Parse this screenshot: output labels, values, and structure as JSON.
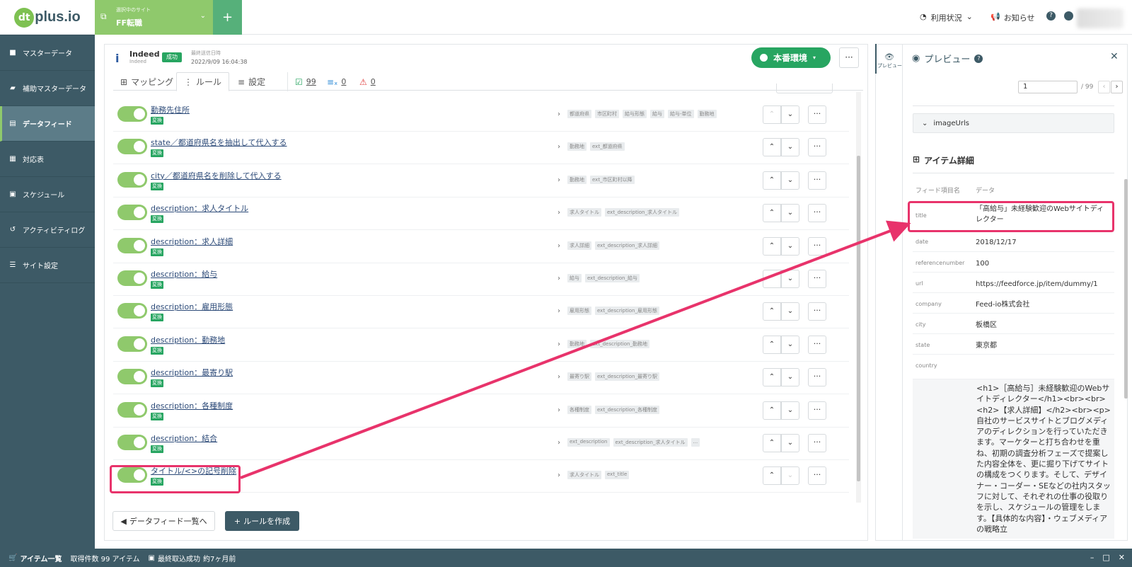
{
  "topbar": {
    "logo_mark": "dt",
    "logo_text": "plus.io",
    "site_label": "選択中のサイト",
    "site_name": "FF転職",
    "add_symbol": "+",
    "usage_label": "利用状況",
    "notice_label": "お知らせ",
    "help_symbol": "?"
  },
  "sidebar": {
    "items": [
      {
        "label": "マスターデータ",
        "icon": "folder-icon"
      },
      {
        "label": "補助マスターデータ",
        "icon": "folder-open-icon"
      },
      {
        "label": "データフィード",
        "icon": "file-icon",
        "active": true
      },
      {
        "label": "対応表",
        "icon": "table-icon"
      },
      {
        "label": "スケジュール",
        "icon": "calendar-icon"
      },
      {
        "label": "アクティビティログ",
        "icon": "history-icon"
      },
      {
        "label": "サイト設定",
        "icon": "sliders-icon"
      }
    ]
  },
  "feed": {
    "name": "Indeed",
    "sub": "Indeed",
    "status": "成功",
    "last_sent_label": "最終送信日時",
    "last_sent": "2022/9/09 16:04:38",
    "env_button": "本番環境",
    "more": "···"
  },
  "tabs": [
    {
      "label": "マッピング",
      "icon": "mapping-icon"
    },
    {
      "label": "ルール",
      "icon": "rule-icon",
      "active": true
    },
    {
      "label": "設定",
      "icon": "settings-icon"
    },
    {
      "count": "99",
      "icon": "check-icon",
      "color": "#27a561"
    },
    {
      "count": "0",
      "icon": "x-icon",
      "color": "#2c8ad6"
    },
    {
      "count": "0",
      "icon": "warning-icon",
      "color": "#e03c3c"
    }
  ],
  "rules": [
    {
      "name": "勤務先住所",
      "badge": "変換",
      "tags": [
        "都道府県",
        "市区町村",
        "給与形態",
        "給与",
        "給与-単位",
        "勤務地"
      ],
      "up_disabled": true
    },
    {
      "name": "state／都道府県名を抽出して代入する",
      "badge": "変換",
      "tags": [
        "勤務地",
        "ext_都道府県"
      ]
    },
    {
      "name": "city／都道府県名を削除して代入する",
      "badge": "変換",
      "tags": [
        "勤務地",
        "ext_市区町村以降"
      ]
    },
    {
      "name": "description：求人タイトル",
      "badge": "変換",
      "tags": [
        "求人タイトル",
        "ext_description_求人タイトル"
      ]
    },
    {
      "name": "description：求人詳細",
      "badge": "変換",
      "tags": [
        "求人詳細",
        "ext_description_求人詳細"
      ]
    },
    {
      "name": "description：給与",
      "badge": "変換",
      "tags": [
        "給与",
        "ext_description_給与"
      ]
    },
    {
      "name": "description：雇用形態",
      "badge": "変換",
      "tags": [
        "雇用形態",
        "ext_description_雇用形態"
      ]
    },
    {
      "name": "description：勤務地",
      "badge": "変換",
      "tags": [
        "勤務地",
        "ext_description_勤務地"
      ]
    },
    {
      "name": "description：最寄り駅",
      "badge": "変換",
      "tags": [
        "最寄り駅",
        "ext_description_最寄り駅"
      ]
    },
    {
      "name": "description：各種制度",
      "badge": "変換",
      "tags": [
        "各種制度",
        "ext_description_各種制度"
      ]
    },
    {
      "name": "description：結合",
      "badge": "変換",
      "tags": [
        "ext_description",
        "ext_description_求人タイトル",
        "..."
      ]
    },
    {
      "name": "タイトル/<>の記号削除",
      "badge": "変換",
      "tags": [
        "求人タイトル",
        "ext_title"
      ],
      "down_disabled": true
    }
  ],
  "bottom": {
    "back_label": "データフィード一覧へ",
    "create_label": "ルールを作成"
  },
  "preview": {
    "toggle_label": "プレビュー",
    "title": "プレビュー",
    "page_value": "1",
    "page_total": "/ 99",
    "section_imageurls": "imageUrls",
    "item_detail_title": "アイテム詳細",
    "col_field": "フィード項目名",
    "col_data": "データ",
    "fields": [
      {
        "key": "title",
        "value": "「高給与」未経験歓迎のWebサイトディレクター"
      },
      {
        "key": "date",
        "value": "2018/12/17"
      },
      {
        "key": "referencenumber",
        "value": "100"
      },
      {
        "key": "url",
        "value": "https://feedforce.jp/item/dummy/1"
      },
      {
        "key": "company",
        "value": "Feed-io株式会社"
      },
      {
        "key": "city",
        "value": "板橋区"
      },
      {
        "key": "state",
        "value": "東京都"
      },
      {
        "key": "country",
        "value": ""
      }
    ],
    "description_text": "<h1>［高給与］未経験歓迎のWebサイトディレクター</h1><br><br><h2>【求人詳細】</h2><br><p>自社のサービスサイトとブログメディアのディレクションを行っていただきます。マーケターと打ち合わせを重ね、初期の調査分析フェーズで提案した内容全体を、更に掘り下げてサイトの構成をつくります。そして、デザイナー・コーダー・SEなどの社内スタッフに対して、それぞれの仕事の役取りを示し、スケジュールの管理をします。【具体的な内容】・ウェブメディアの戦略立"
  },
  "statusbar": {
    "items_label": "アイテム一覧",
    "count_text": "取得件数 99 アイテム",
    "last_label": "最終取込成功",
    "last_value": "約7ヶ月前"
  },
  "colors": {
    "accent": "#27a561",
    "sidebar": "#3d5a66",
    "highlight": "#e8336b",
    "site": "#8fc96c"
  }
}
